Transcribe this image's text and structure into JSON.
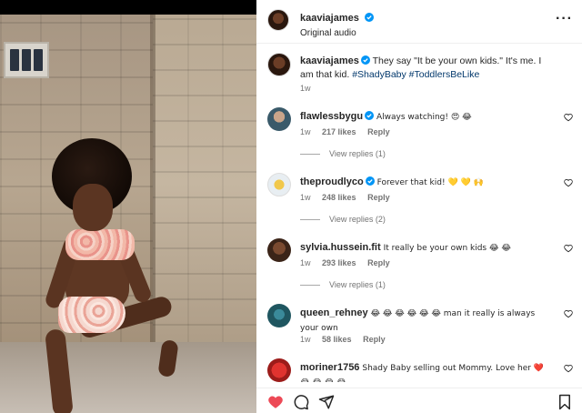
{
  "post": {
    "username": "kaaviajames",
    "audio": "Original audio",
    "caption_user": "kaaviajames",
    "caption_text": "They say \"It be your own kids.\" It's me. I am that kid.",
    "hashtags": "#ShadyBaby #ToddlersBeLike",
    "caption_time": "1w"
  },
  "comments": [
    {
      "user": "flawlessbygu",
      "text": "Always watching! 😍 😂",
      "time": "1w",
      "likes": "217 likes",
      "reply": "Reply",
      "view_replies": "View replies (1)",
      "verified": true
    },
    {
      "user": "theproudlyco",
      "text": "Forever that kid! 💛 💛 🙌",
      "time": "1w",
      "likes": "248 likes",
      "reply": "Reply",
      "view_replies": "View replies (2)",
      "verified": true
    },
    {
      "user": "sylvia.hussein.fit",
      "text": "It really be your own kids 😂 😂",
      "time": "1w",
      "likes": "293 likes",
      "reply": "Reply",
      "view_replies": "View replies (1)",
      "verified": false
    },
    {
      "user": "queen_rehney",
      "text": "😂 😂 😂 😂 😂 😂 man it really is always your own",
      "time": "1w",
      "likes": "58 likes",
      "reply": "Reply",
      "verified": false
    },
    {
      "user": "moriner1756",
      "text": "Shady Baby selling out Mommy. Love her ❤️ 😂 😂 😂 😂",
      "verified": false
    }
  ],
  "icons": [
    "more-icon",
    "like-icon",
    "comment-icon",
    "share-icon",
    "save-icon",
    "verified-icon",
    "heart-icon"
  ],
  "colors": {
    "like_red": "#ed4956",
    "verified_blue": "#0095f6",
    "hashtag": "#00376b"
  }
}
